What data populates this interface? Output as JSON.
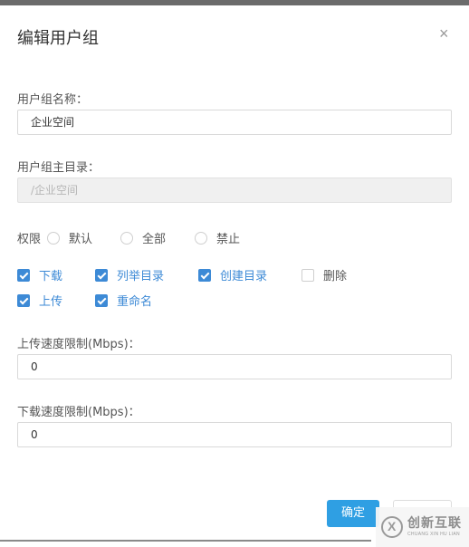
{
  "dialog": {
    "title": "编辑用户组",
    "close_icon": "×"
  },
  "form": {
    "group_name": {
      "label": "用户组名称：",
      "value": "企业空间"
    },
    "home_dir": {
      "label": "用户组主目录：",
      "value": "/企业空间"
    },
    "permission": {
      "label": "权限",
      "options": [
        "默认",
        "全部",
        "禁止"
      ],
      "selected": null
    },
    "checkboxes": [
      {
        "label": "下载",
        "checked": true
      },
      {
        "label": "列举目录",
        "checked": true
      },
      {
        "label": "创建目录",
        "checked": true
      },
      {
        "label": "删除",
        "checked": false
      },
      {
        "label": "上传",
        "checked": true
      },
      {
        "label": "重命名",
        "checked": true
      }
    ],
    "upload_limit": {
      "label": "上传速度限制(Mbps)：",
      "value": "0"
    },
    "download_limit": {
      "label": "下载速度限制(Mbps)：",
      "value": "0"
    }
  },
  "footer": {
    "confirm_label": "确定",
    "cancel_label": ""
  },
  "watermark": {
    "text": "创新互联",
    "subtext": "CHUANG XIN HU LIAN"
  },
  "colors": {
    "accent": "#3d8ad6",
    "confirm_button": "#2f9fe3"
  }
}
